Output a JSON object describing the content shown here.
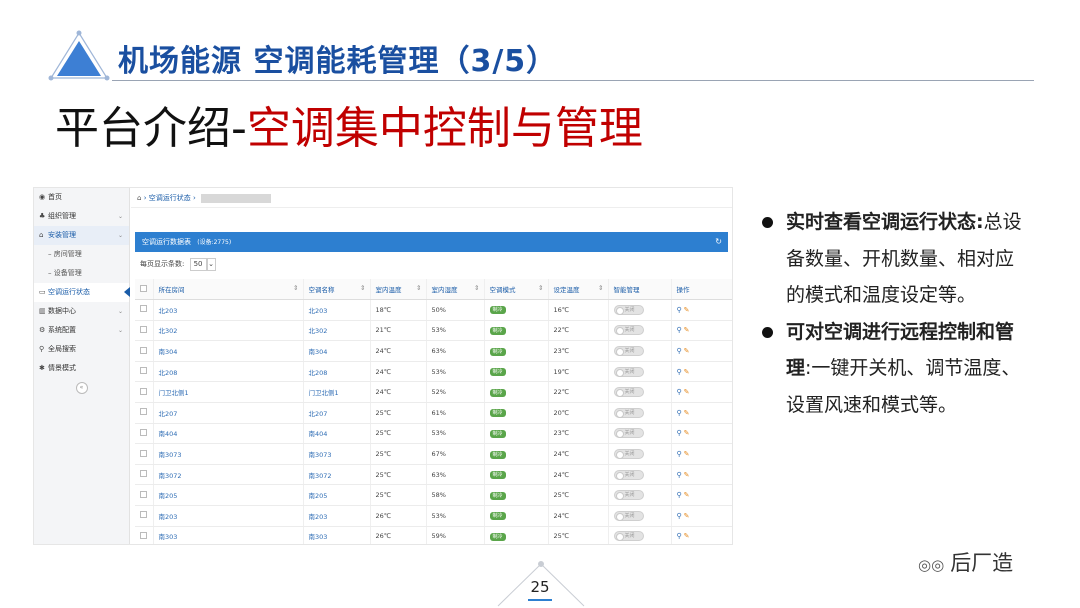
{
  "header": {
    "title": "机场能源 空调能耗管理（3/5）",
    "subtitle_black": "平台介绍-",
    "subtitle_red": "空调集中控制与管理"
  },
  "colors": {
    "header_blue": "#1a4fa0",
    "subtitle_red": "#c00000",
    "panel_blue": "#2d7fd0",
    "mode_green": "#5aa54a"
  },
  "screenshot": {
    "sidebar": {
      "items": [
        {
          "icon": "globe-icon",
          "glyph": "◉",
          "label": "首页"
        },
        {
          "icon": "org-icon",
          "glyph": "♣",
          "label": "组织管理",
          "chevron": "⌄"
        },
        {
          "icon": "home-icon",
          "glyph": "⌂",
          "label": "安装管理",
          "chevron": "⌄"
        },
        {
          "label": "房间管理",
          "sub": true
        },
        {
          "label": "设备管理",
          "sub": true
        },
        {
          "icon": "monitor-icon",
          "glyph": "▭",
          "label": "空调运行状态"
        },
        {
          "icon": "bar-chart-icon",
          "glyph": "▥",
          "label": "数据中心",
          "chevron": "⌄"
        },
        {
          "icon": "gear-icon",
          "glyph": "⚙",
          "label": "系统配置",
          "chevron": "⌄"
        },
        {
          "icon": "search-icon",
          "glyph": "⚲",
          "label": "全局搜索"
        },
        {
          "icon": "star-icon",
          "glyph": "✱",
          "label": "情景模式"
        }
      ],
      "collapse_glyph": "«"
    },
    "breadcrumb": {
      "home_glyph": "⌂",
      "item": "空调运行状态"
    },
    "panel": {
      "title": "空调运行数据表",
      "count": "(设备:2775)",
      "refresh_glyph": "↻"
    },
    "per_page": {
      "label": "每页显示条数:",
      "value": "50",
      "arrow": "⌄"
    },
    "table": {
      "headers": [
        "所在房间",
        "空调名称",
        "室内温度",
        "室内湿度",
        "空调模式",
        "设定温度",
        "智能管理",
        "操作"
      ],
      "sort_glyph": "⇕",
      "mode_label": "制冷",
      "toggle_label": "关闭",
      "view_glyph": "⚲",
      "edit_glyph": "✎",
      "rows": [
        {
          "room": "北203",
          "name": "北203",
          "temp": "18℃",
          "hum": "50%",
          "set": "16℃"
        },
        {
          "room": "北302",
          "name": "北302",
          "temp": "21℃",
          "hum": "53%",
          "set": "22℃"
        },
        {
          "room": "南304",
          "name": "南304",
          "temp": "24℃",
          "hum": "63%",
          "set": "23℃"
        },
        {
          "room": "北208",
          "name": "北208",
          "temp": "24℃",
          "hum": "53%",
          "set": "19℃"
        },
        {
          "room": "门卫北侧1",
          "name": "门卫北侧1",
          "temp": "24℃",
          "hum": "52%",
          "set": "22℃"
        },
        {
          "room": "北207",
          "name": "北207",
          "temp": "25℃",
          "hum": "61%",
          "set": "20℃"
        },
        {
          "room": "南404",
          "name": "南404",
          "temp": "25℃",
          "hum": "53%",
          "set": "23℃"
        },
        {
          "room": "南3073",
          "name": "南3073",
          "temp": "25℃",
          "hum": "67%",
          "set": "24℃"
        },
        {
          "room": "南3072",
          "name": "南3072",
          "temp": "25℃",
          "hum": "63%",
          "set": "24℃"
        },
        {
          "room": "南205",
          "name": "南205",
          "temp": "25℃",
          "hum": "58%",
          "set": "25℃"
        },
        {
          "room": "南203",
          "name": "南203",
          "temp": "26℃",
          "hum": "53%",
          "set": "24℃"
        },
        {
          "room": "南303",
          "name": "南303",
          "temp": "26℃",
          "hum": "59%",
          "set": "25℃"
        }
      ]
    }
  },
  "bullets": [
    {
      "bold": "实时查看空调运行状态:",
      "text": "总设备数量、开机数量、相对应的模式和温度设定等。"
    },
    {
      "bold": "可对空调进行远程控制和管理",
      "text": ":一键开关机、调节温度、设置风速和模式等。"
    }
  ],
  "footer": {
    "page_number": "25",
    "brand": "后厂造",
    "brand_icon": "wechat-icon"
  }
}
